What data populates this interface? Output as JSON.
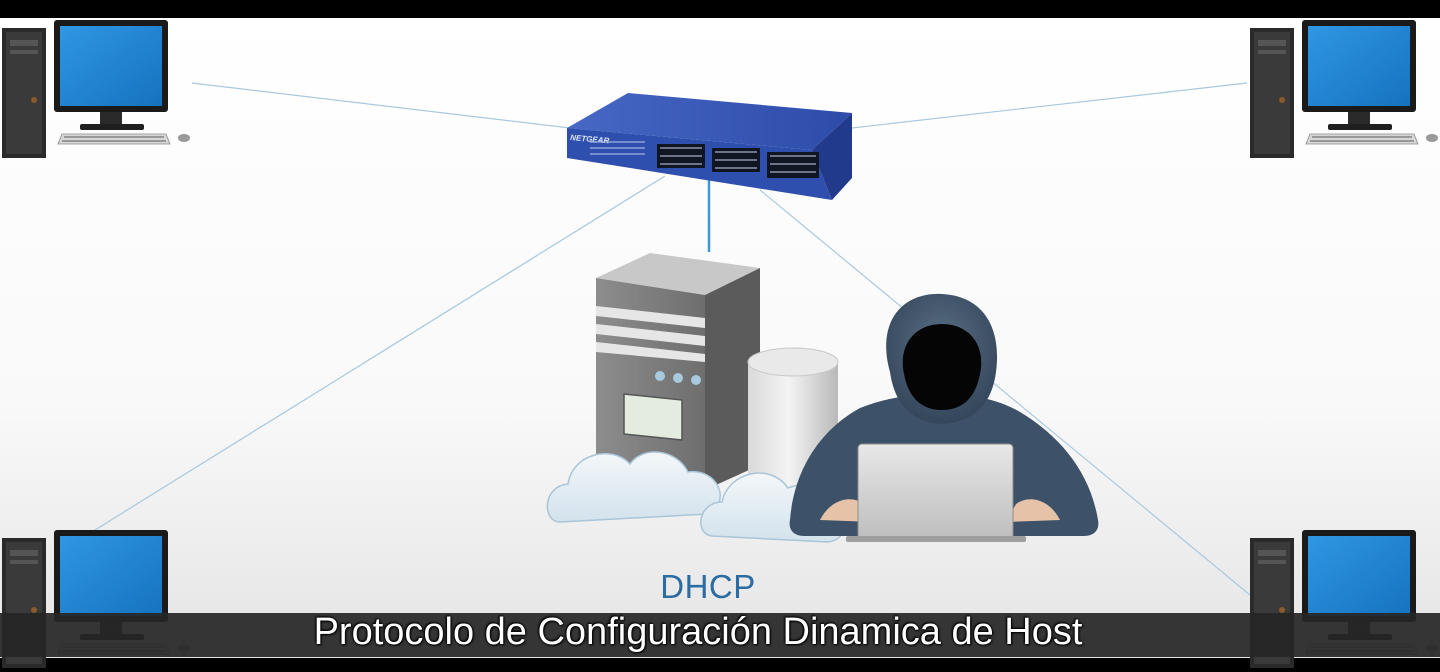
{
  "diagram": {
    "switch_brand": "NETGEAR",
    "server_label": "DHCP",
    "computers": [
      "top-left",
      "top-right",
      "bottom-left",
      "bottom-right"
    ],
    "icons": [
      "network-switch-icon",
      "server-tower-icon",
      "database-cylinder-icon",
      "cloud-icon",
      "hacker-icon",
      "laptop-icon",
      "desktop-computer-icon"
    ],
    "colors": {
      "link": "#9fc3dd",
      "uplink": "#3b9ad4",
      "switch": "#2f4fae",
      "monitor_screen": "#1e86d6",
      "label": "#2b6ca3"
    }
  },
  "subtitle": "Protocolo de Configuración Dinamica de Host"
}
